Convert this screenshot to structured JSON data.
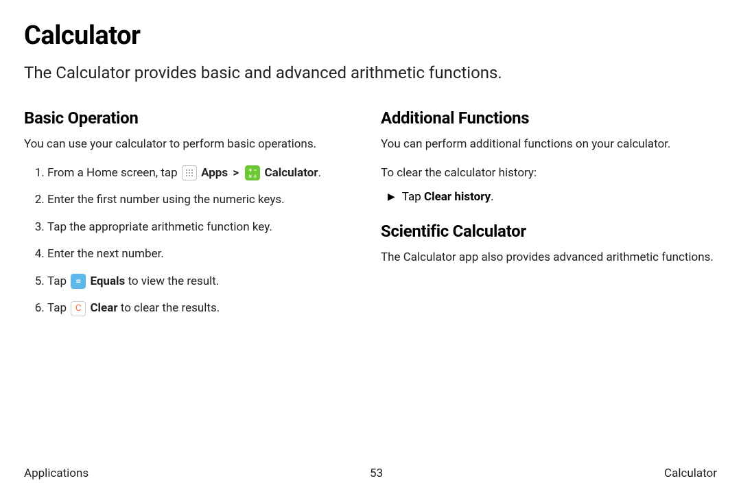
{
  "title": "Calculator",
  "intro": "The Calculator provides basic and advanced arithmetic functions.",
  "left": {
    "heading": "Basic Operation",
    "desc": "You can use your calculator to perform basic operations.",
    "step1_pre": "From a Home screen, tap",
    "apps_label": "Apps",
    "breadcrumb_sep": ">",
    "calculator_label": "Calculator",
    "step1_post": ".",
    "step2": "Enter the first number using the numeric keys.",
    "step3": "Tap the appropriate arithmetic function key.",
    "step4": "Enter the next number.",
    "step5_pre": "Tap",
    "equals_label": "Equals",
    "step5_post": " to view the result.",
    "step6_pre": "Tap",
    "clear_symbol": "C",
    "clear_label": "Clear",
    "step6_post": " to clear the results."
  },
  "right": {
    "heading1": "Additional Functions",
    "desc1": "You can perform additional functions on your calculator.",
    "clear_hist_intro": "To clear the calculator history:",
    "arrow": "▶",
    "clear_hist_action_pre": "Tap ",
    "clear_hist_bold": "Clear history",
    "clear_hist_action_post": ".",
    "heading2": "Scientific Calculator",
    "desc2": "The Calculator app also provides advanced arithmetic functions."
  },
  "footer": {
    "left": "Applications",
    "center": "53",
    "right": "Calculator"
  }
}
